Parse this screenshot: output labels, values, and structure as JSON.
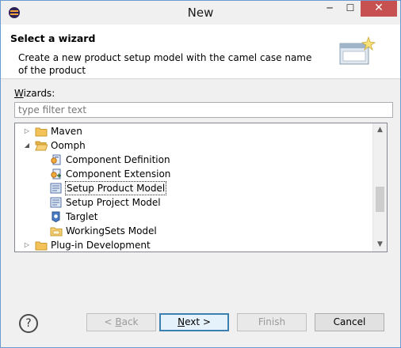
{
  "window": {
    "title": "New"
  },
  "titlebar": {
    "minimize": "─",
    "maximize": "☐",
    "close": "✕"
  },
  "header": {
    "title": "Select a wizard",
    "description": "Create a new product setup model with the camel case name of the product"
  },
  "wizards_label": {
    "prefix": "W",
    "rest": "izards:"
  },
  "filter": {
    "placeholder": "type filter text",
    "value": ""
  },
  "tree": {
    "items": [
      {
        "label": "Maven",
        "icon": "folder-icon",
        "expanded": false,
        "level": 0
      },
      {
        "label": "Oomph",
        "icon": "folder-open-icon",
        "expanded": true,
        "level": 0
      },
      {
        "label": "Component Definition",
        "icon": "component-definition-icon",
        "level": 1
      },
      {
        "label": "Component Extension",
        "icon": "component-extension-icon",
        "level": 1
      },
      {
        "label": "Setup Product Model",
        "icon": "setup-model-icon",
        "level": 1,
        "selected": true
      },
      {
        "label": "Setup Project Model",
        "icon": "setup-model-icon",
        "level": 1
      },
      {
        "label": "Targlet",
        "icon": "targlet-icon",
        "level": 1
      },
      {
        "label": "WorkingSets Model",
        "icon": "workingsets-icon",
        "level": 1
      },
      {
        "label": "Plug-in Development",
        "icon": "folder-icon",
        "expanded": false,
        "level": 0
      }
    ]
  },
  "buttons": {
    "help": "?",
    "back_prefix": "< ",
    "back_mnemonic": "B",
    "back_rest": "ack",
    "next_mnemonic": "N",
    "next_rest": "ext >",
    "finish": "Finish",
    "cancel": "Cancel"
  },
  "colors": {
    "accent": "#3c7fb1",
    "folder": "#f3c35a",
    "close": "#c75050"
  }
}
